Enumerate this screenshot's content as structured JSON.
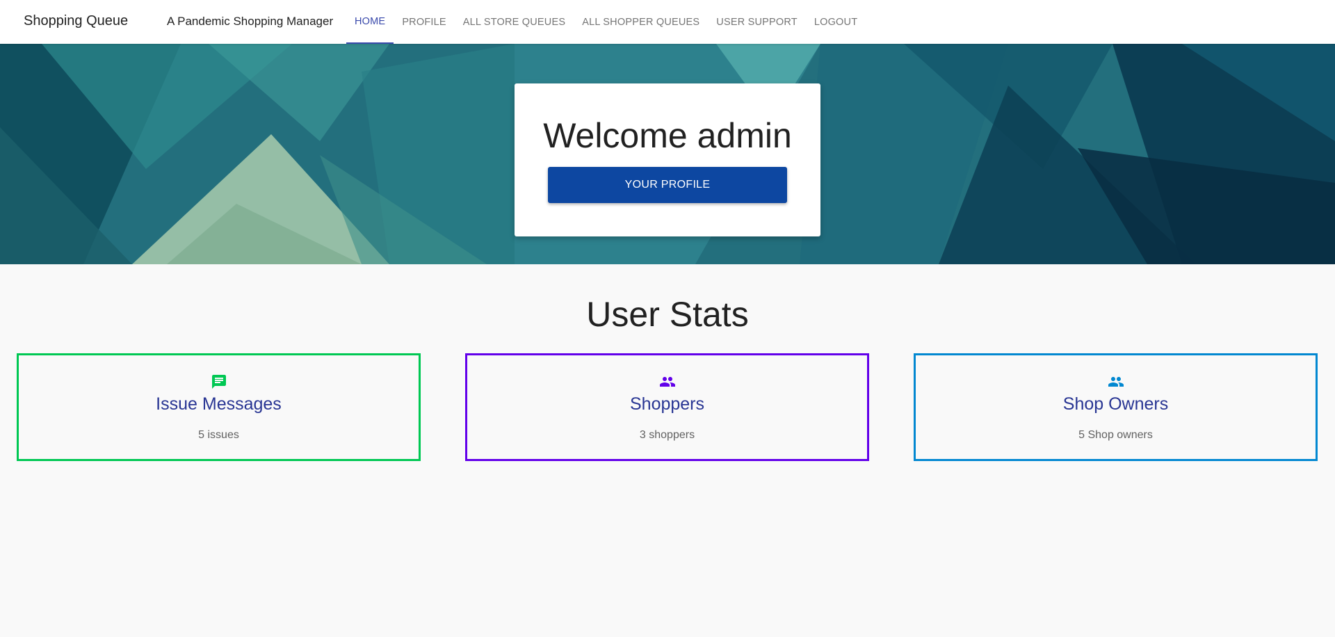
{
  "header": {
    "brand": "Shopping Queue",
    "tagline": "A Pandemic Shopping Manager",
    "nav": [
      {
        "label": "HOME",
        "active": true
      },
      {
        "label": "PROFILE",
        "active": false
      },
      {
        "label": "ALL STORE QUEUES",
        "active": false
      },
      {
        "label": "ALL SHOPPER QUEUES",
        "active": false
      },
      {
        "label": "USER SUPPORT",
        "active": false
      },
      {
        "label": "LOGOUT",
        "active": false
      }
    ]
  },
  "hero": {
    "welcome_title": "Welcome admin",
    "profile_button": "YOUR PROFILE"
  },
  "stats": {
    "title": "User Stats",
    "cards": [
      {
        "icon": "message-icon",
        "title": "Issue Messages",
        "value": "5 issues",
        "color": "#00c853"
      },
      {
        "icon": "people-icon",
        "title": "Shoppers",
        "value": "3 shoppers",
        "color": "#6200ea"
      },
      {
        "icon": "people-icon",
        "title": "Shop Owners",
        "value": "5 Shop owners",
        "color": "#0288d1"
      }
    ]
  },
  "colors": {
    "nav_active": "#3949ab",
    "primary_button": "#0d47a1",
    "card_title": "#283593"
  }
}
